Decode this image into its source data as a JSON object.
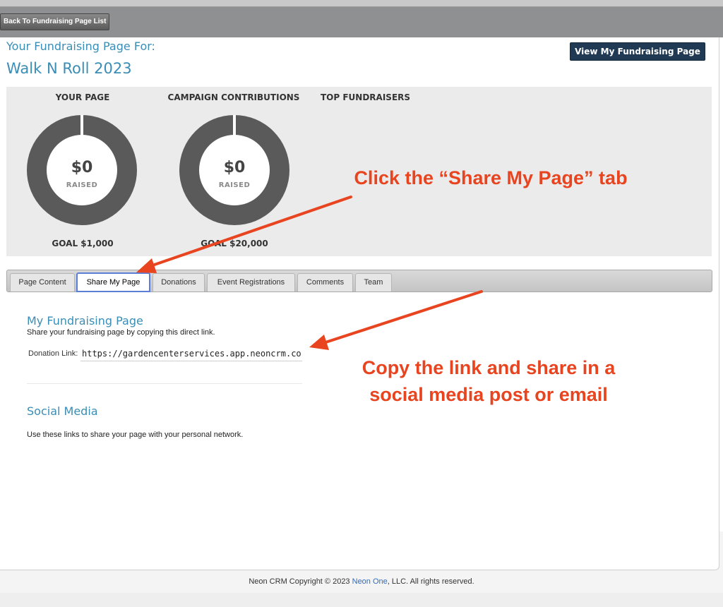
{
  "toolbar": {
    "back_label": "Back To Fundraising Page List"
  },
  "header": {
    "pre_title": "Your Fundraising Page For:",
    "campaign_title": "Walk N Roll 2023",
    "view_button": "View My Fundraising Page"
  },
  "stats": {
    "your_page": {
      "heading": "YOUR PAGE",
      "amount": "$0",
      "raised_label": "RAISED",
      "goal": "GOAL $1,000",
      "progress": 0
    },
    "campaign": {
      "heading": "CAMPAIGN CONTRIBUTIONS",
      "amount": "$0",
      "raised_label": "RAISED",
      "goal": "GOAL $20,000",
      "progress": 0
    },
    "top_fundraisers": {
      "heading": "TOP FUNDRAISERS"
    }
  },
  "tabs": [
    {
      "label": "Page Content",
      "active": false
    },
    {
      "label": "Share My Page",
      "active": true
    },
    {
      "label": "Donations",
      "active": false
    },
    {
      "label": "Event Registrations",
      "active": false
    },
    {
      "label": "Comments",
      "active": false
    },
    {
      "label": "Team",
      "active": false
    }
  ],
  "share": {
    "title": "My Fundraising Page",
    "description": "Share your fundraising page by copying this direct link.",
    "link_label": "Donation Link:",
    "link_value": "https://gardencenterservices.app.neoncrm.com/anne"
  },
  "social": {
    "title": "Social Media",
    "description": "Use these links to share your page with your personal network."
  },
  "annotations": {
    "callout_1": "Click the “Share My Page” tab",
    "callout_2_line1": "Copy the link and share in a",
    "callout_2_line2": "social media post or email",
    "color": "#e8441f"
  },
  "footer": {
    "prefix": "Neon CRM Copyright © 2023 ",
    "link": "Neon One",
    "suffix": ", LLC. All rights reserved."
  }
}
